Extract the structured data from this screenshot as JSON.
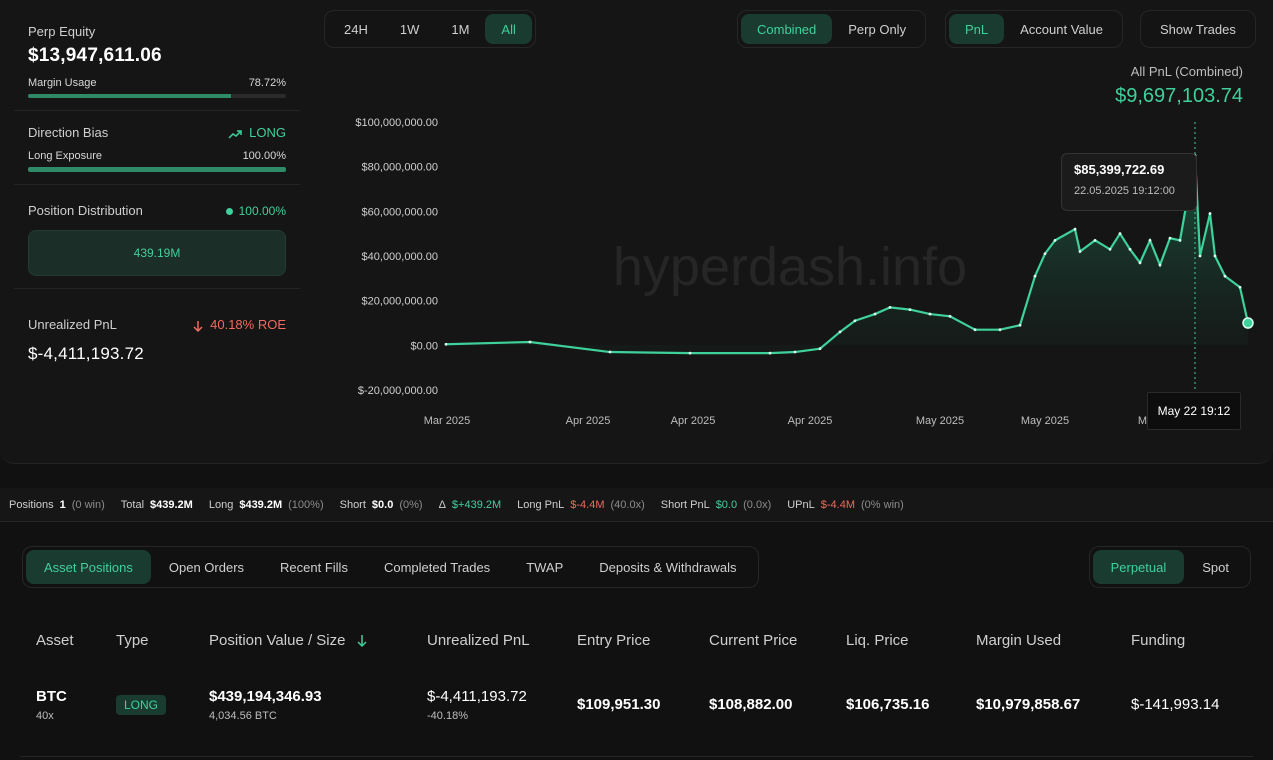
{
  "left": {
    "equity_label": "Perp Equity",
    "equity_value": "$13,947,611.06",
    "margin_label": "Margin Usage",
    "margin_value": "78.72%",
    "margin_fraction": 0.7872,
    "bias_label": "Direction Bias",
    "bias_value": "LONG",
    "long_exp_label": "Long Exposure",
    "long_exp_value": "100.00%",
    "long_exp_fraction": 1.0,
    "dist_label": "Position Distribution",
    "dist_value": "100.00%",
    "dist_amount": "439.19M",
    "upnl_label": "Unrealized PnL",
    "upnl_roe": "40.18% ROE",
    "upnl_value": "$-4,411,193.72"
  },
  "timeframes": [
    "24H",
    "1W",
    "1M",
    "All"
  ],
  "timeframe_active": "All",
  "mode_buttons": [
    "Combined",
    "Perp Only"
  ],
  "metric_buttons": [
    "PnL",
    "Account Value"
  ],
  "show_trades": "Show Trades",
  "pnl_summary": {
    "label": "All PnL (Combined)",
    "value": "$9,697,103.74"
  },
  "watermark": "hyperdash.info",
  "tooltip": {
    "value": "$85,399,722.69",
    "date": "22.05.2025 19:12:00",
    "x_label": "May 22 19:12"
  },
  "chart_data": {
    "type": "area",
    "title": "",
    "ylim": [
      -20000000,
      100000000
    ],
    "y_ticks": [
      "$100,000,000.00",
      "$80,000,000.00",
      "$60,000,000.00",
      "$40,000,000.00",
      "$20,000,000.00",
      "$0.00",
      "$-20,000,000.00"
    ],
    "x_ticks": [
      "Mar 2025",
      "Apr 2025",
      "Apr 2025",
      "Apr 2025",
      "May 2025",
      "May 2025",
      "May 2025"
    ],
    "series": [
      {
        "values": [
          0.5,
          1.5,
          -3,
          -3.5,
          -3.5,
          -3.0,
          -1.5,
          6,
          11,
          14,
          17,
          16,
          14,
          13,
          7,
          7,
          9,
          31,
          41,
          47,
          52,
          42,
          47,
          43,
          50,
          43,
          37,
          47,
          36,
          48,
          47,
          85,
          40,
          59,
          40,
          31,
          26,
          10
        ]
      }
    ],
    "color": "#3fd19c",
    "grid": false
  },
  "strip": {
    "positions_label": "Positions",
    "positions_value": "1",
    "positions_note": "(0 win)",
    "total_label": "Total",
    "total_value": "$439.2M",
    "long_label": "Long",
    "long_value": "$439.2M",
    "long_note": "(100%)",
    "short_label": "Short",
    "short_value": "$0.0",
    "short_note": "(0%)",
    "delta_label": "Δ",
    "delta_value": "$+439.2M",
    "longpnl_label": "Long PnL",
    "longpnl_value": "$-4.4M",
    "longpnl_note": "(40.0x)",
    "shortpnl_label": "Short PnL",
    "shortpnl_value": "$0.0",
    "shortpnl_note": "(0.0x)",
    "upnl_label": "UPnL",
    "upnl_value": "$-4.4M",
    "upnl_note": "(0% win)"
  },
  "tabs": [
    "Asset Positions",
    "Open Orders",
    "Recent Fills",
    "Completed Trades",
    "TWAP",
    "Deposits & Withdrawals"
  ],
  "market_tabs": [
    "Perpetual",
    "Spot"
  ],
  "table": {
    "headers": [
      "Asset",
      "Type",
      "Position Value / Size",
      "Unrealized PnL",
      "Entry Price",
      "Current Price",
      "Liq. Price",
      "Margin Used",
      "Funding"
    ],
    "row": {
      "asset": "BTC",
      "leverage": "40x",
      "type": "LONG",
      "value": "$439,194,346.93",
      "size": "4,034.56 BTC",
      "upnl": "$-4,411,193.72",
      "upnl_pct": "-40.18%",
      "entry": "$109,951.30",
      "current": "$108,882.00",
      "liq": "$106,735.16",
      "margin": "$10,979,858.67",
      "funding": "$-141,993.14"
    }
  }
}
